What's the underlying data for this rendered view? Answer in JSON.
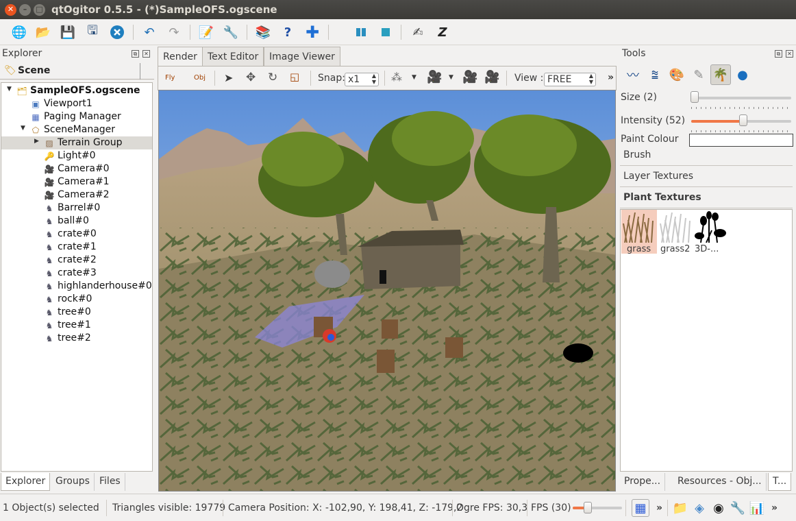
{
  "window": {
    "title": "qtOgitor 0.5.5 - (*)SampleOFS.ogscene"
  },
  "toolbar": {
    "icons": [
      "globe-icon",
      "folder-open-icon",
      "save-icon",
      "save-as-icon",
      "close-icon",
      "undo-icon",
      "redo-icon",
      "edit-icon",
      "tools-icon",
      "books-icon",
      "help-icon",
      "add-icon",
      "layout-icon",
      "view-icon",
      "draw-icon",
      "zzz-icon"
    ]
  },
  "explorer": {
    "title": "Explorer",
    "tab": "Scene",
    "tree": [
      {
        "label": "SampleOFS.ogscene",
        "depth": 0,
        "arrow": "▼",
        "icon": "folder-icon",
        "bold": true
      },
      {
        "label": "Viewport1",
        "depth": 1,
        "icon": "viewport-icon"
      },
      {
        "label": "Paging Manager",
        "depth": 1,
        "icon": "grid-icon"
      },
      {
        "label": "SceneManager",
        "depth": 1,
        "arrow": "▼",
        "icon": "scenemanager-icon"
      },
      {
        "label": "Terrain Group",
        "depth": 2,
        "arrow": "▶",
        "icon": "terrain-icon",
        "selected": true
      },
      {
        "label": "Light#0",
        "depth": 2,
        "icon": "light-icon"
      },
      {
        "label": "Camera#0",
        "depth": 2,
        "icon": "camera-icon"
      },
      {
        "label": "Camera#1",
        "depth": 2,
        "icon": "camera-icon"
      },
      {
        "label": "Camera#2",
        "depth": 2,
        "icon": "camera-icon"
      },
      {
        "label": "Barrel#0",
        "depth": 2,
        "icon": "entity-icon"
      },
      {
        "label": "ball#0",
        "depth": 2,
        "icon": "entity-icon"
      },
      {
        "label": "crate#0",
        "depth": 2,
        "icon": "entity-icon"
      },
      {
        "label": "crate#1",
        "depth": 2,
        "icon": "entity-icon"
      },
      {
        "label": "crate#2",
        "depth": 2,
        "icon": "entity-icon"
      },
      {
        "label": "crate#3",
        "depth": 2,
        "icon": "entity-icon"
      },
      {
        "label": "highlanderhouse#0",
        "depth": 2,
        "icon": "entity-icon"
      },
      {
        "label": "rock#0",
        "depth": 2,
        "icon": "entity-icon"
      },
      {
        "label": "tree#0",
        "depth": 2,
        "icon": "entity-icon"
      },
      {
        "label": "tree#1",
        "depth": 2,
        "icon": "entity-icon"
      },
      {
        "label": "tree#2",
        "depth": 2,
        "icon": "entity-icon"
      }
    ],
    "bottom_tabs": [
      "Explorer",
      "Groups",
      "Files"
    ]
  },
  "center": {
    "tabs": [
      "Render",
      "Text Editor",
      "Image Viewer"
    ],
    "toolbar": {
      "fly": "Fly",
      "obj": "Obj",
      "snap_label": "Snap:",
      "snap_value": "x1",
      "view_label": "View :",
      "view_value": "FREE",
      "more": "»"
    }
  },
  "tools": {
    "title": "Tools",
    "size_label": "Size (2)",
    "size_value": 2,
    "intensity_label": "Intensity (52)",
    "intensity_value": 52,
    "paint_colour_label": "Paint Colour",
    "sections": [
      "Brush",
      "Layer Textures",
      "Plant Textures"
    ],
    "plants": [
      "grass",
      "grass2",
      "3D-..."
    ],
    "bottom_tabs": [
      "Prope...",
      "Resources - Obj...",
      "T..."
    ]
  },
  "status": {
    "selected": "1 Object(s) selected",
    "triangles": "Triangles visible: 19779",
    "camera": "Camera Position: X: -102,90, Y:  198,41, Z: -179,2",
    "ogre_fps": "Ogre FPS: 30,3",
    "fps": "FPS (30)",
    "fps_value": 30,
    "more": "»"
  },
  "colors": {
    "accent": "#f07746",
    "selection": "#dcdad5",
    "sky": "#7fa9e2"
  }
}
